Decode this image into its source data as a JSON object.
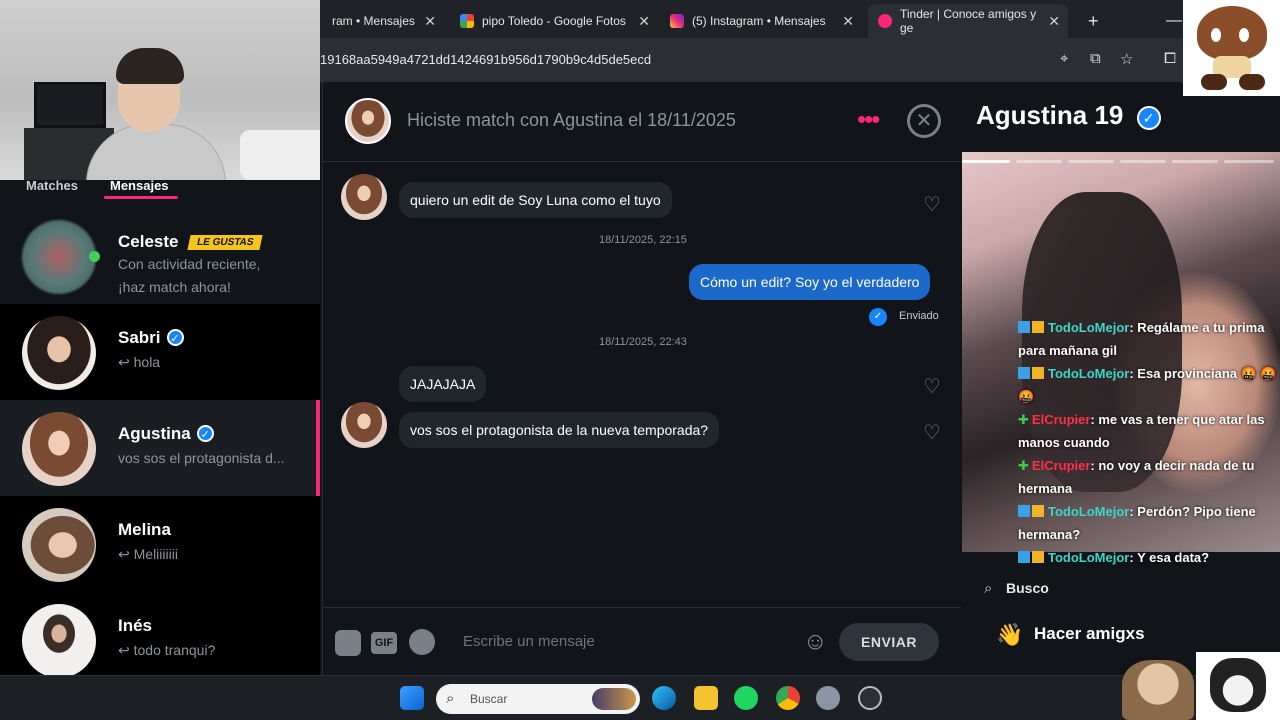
{
  "browser": {
    "tabs": [
      {
        "label": "ram • Mensajes",
        "color": "#e1306c"
      },
      {
        "label": "pipo Toledo - Google Fotos",
        "color": "#34a853"
      },
      {
        "label": "(5) Instagram • Mensajes",
        "color": "#d62976"
      },
      {
        "label": "Tinder | Conoce amigos y ge",
        "color": "#fd267a"
      }
    ],
    "new_tab": "+",
    "url": "19168aa5949a4721dd1424691b956d1790b9c4d5de5ecd"
  },
  "sidebar": {
    "tab_matches": "Matches",
    "tab_messages": "Mensajes",
    "conversations": [
      {
        "name": "Celeste",
        "badge": "LE GUSTAS",
        "preview": "Con actividad reciente,",
        "preview2": "¡haz match ahora!",
        "online": true
      },
      {
        "name": "Sabri",
        "preview": "↩ hola",
        "verified": true
      },
      {
        "name": "Agustina",
        "preview": "vos sos el protagonista d...",
        "verified": true,
        "active": true
      },
      {
        "name": "Melina",
        "preview": "↩ Meliiiiiii"
      },
      {
        "name": "Inés",
        "preview": "↩ todo tranqui?"
      }
    ]
  },
  "chat": {
    "match_text": "Hiciste match con Agustina el 18/11/2025",
    "more_label": "•••",
    "messages": [
      {
        "text": "quiero un edit de Soy Luna como el tuyo",
        "direction": "in"
      },
      {
        "text": "18/11/2025, 22:15",
        "direction": "timestamp"
      },
      {
        "text": "Cómo un edit? Soy yo el verdadero",
        "direction": "out"
      },
      {
        "text": "Enviado",
        "direction": "status"
      },
      {
        "text": "18/11/2025, 22:43",
        "direction": "timestamp"
      },
      {
        "text": "JAJAJAJA",
        "direction": "in"
      },
      {
        "text": "vos sos el protagonista de la nueva temporada?",
        "direction": "in"
      }
    ],
    "input_placeholder": "Escribe un mensaje",
    "gif_label": "GIF",
    "send_label": "ENVIAR"
  },
  "profile": {
    "name": "Agustina",
    "age": "19",
    "photo_count": 6,
    "photo_index": 1,
    "busco_label": "Busco",
    "interest": "Hacer amigxs"
  },
  "stream_chat": [
    {
      "user": "TodoLoMejor",
      "color": "#3dd6c8",
      "text": ": Regálame a tu prima para mañana gil",
      "badge": "mod"
    },
    {
      "user": "TodoLoMejor",
      "color": "#3dd6c8",
      "text": ": Esa provinciana 🤬 🤬 🤬",
      "badge": "mod"
    },
    {
      "user": "ElCrupier",
      "color": "#ff2e4a",
      "text": ": me vas a tener que atar las manos cuando",
      "badge": "plus"
    },
    {
      "user": "ElCrupier",
      "color": "#ff2e4a",
      "text": ": no voy a decir nada de tu hermana",
      "badge": "plus"
    },
    {
      "user": "TodoLoMejor",
      "color": "#3dd6c8",
      "text": ": Perdón? Pipo tiene hermana?",
      "badge": "mod"
    },
    {
      "user": "TodoLoMejor",
      "color": "#3dd6c8",
      "text": ": Y esa data?",
      "badge": "mod"
    }
  ],
  "taskbar": {
    "search_placeholder": "Buscar"
  },
  "colors": {
    "tinder_pink": "#fd267a",
    "verified_blue": "#1786ff",
    "bubble_out": "#1b6ac9",
    "badge_yellow": "#f5c518"
  }
}
